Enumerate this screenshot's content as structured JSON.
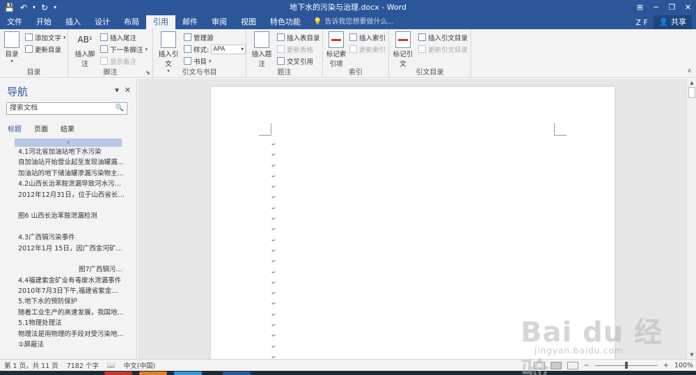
{
  "titlebar": {
    "title": "地下水的污染与治理.docx - Word",
    "save_icon": "💾",
    "undo_icon": "↶",
    "redo_icon": "↻",
    "dropdown_icon": "▾",
    "ribbon_display_icon": "⊞",
    "minimize_icon": "─",
    "restore_icon": "❐",
    "close_icon": "✕"
  },
  "tabs": [
    "文件",
    "开始",
    "插入",
    "设计",
    "布局",
    "引用",
    "邮件",
    "审阅",
    "视图",
    "特色功能"
  ],
  "active_tab": "引用",
  "tellme": {
    "icon": "💡",
    "text": "告诉我您想要做什么..."
  },
  "user": {
    "initials": "Z F",
    "share_icon": "👤",
    "share_label": "共享"
  },
  "ribbon": {
    "toc": {
      "label": "目录",
      "toc_button": "目录",
      "add_text": "添加文字",
      "update_toc": "更新目录"
    },
    "footnotes": {
      "label": "脚注",
      "insert_footnote": "插入脚注",
      "footnote_icon": "AB¹",
      "insert_endnote": "插入尾注",
      "next_footnote": "下一条脚注",
      "show_notes": "显示备注"
    },
    "citations": {
      "label": "引文与书目",
      "insert_citation": "插入引文",
      "manage_sources": "管理源",
      "style_label": "样式:",
      "style_value": "APA",
      "bibliography": "书目"
    },
    "captions": {
      "label": "题注",
      "insert_caption": "插入题注",
      "insert_table_of_figures": "插入表目录",
      "update_table": "更新表格",
      "cross_reference": "交叉引用"
    },
    "index": {
      "label": "索引",
      "mark_entry": "标记索引项",
      "insert_index": "插入索引",
      "update_index": "更新索引"
    },
    "toa": {
      "label": "引文目录",
      "mark_citation": "标记引文",
      "insert_toa": "插入引文目录",
      "update_toa": "更新引文目录"
    },
    "collapse_icon": "∧"
  },
  "navigation": {
    "title": "导航",
    "search_placeholder": "搜索文档",
    "search_icon": "🔍",
    "tabs": [
      "标题",
      "页面",
      "结果"
    ],
    "active_tab": "标题",
    "collapse_arrow": "⩡",
    "headings": [
      {
        "text": "4.1河北省加油站地下水污染",
        "indent": false
      },
      {
        "text": "自加油站开始营业起至发现油罐漏...",
        "indent": false
      },
      {
        "text": "加油站的地下储油罐渗漏污染物主...",
        "indent": false
      },
      {
        "text": "4.2山西长治苯胺泄漏导致河水污染...",
        "indent": false
      },
      {
        "text": "2012年12月31日，位于山西省长治...",
        "indent": false
      },
      {
        "text": "",
        "indent": false
      },
      {
        "text": "图6  山西长治苯胺泄漏检测",
        "indent": false
      },
      {
        "text": "",
        "indent": false
      },
      {
        "text": "4.3广西镉污染事件",
        "indent": false
      },
      {
        "text": "2012年1月 15日，因广西金河矿业...",
        "indent": false
      },
      {
        "text": "",
        "indent": false
      },
      {
        "text": "图7广西镉污...",
        "indent": true
      },
      {
        "text": "4.4福建紫金矿业有毒废水泄漏事件",
        "indent": false
      },
      {
        "text": "2010年7月3日下午,福建省紫金矿业...",
        "indent": false
      },
      {
        "text": "5.地下水的预防保护",
        "indent": false
      },
      {
        "text": "随着工业生产的高速发展，我国地...",
        "indent": false
      },
      {
        "text": "5.1物理处理法",
        "indent": false
      },
      {
        "text": "物理法是用物理的手段对受污染地...",
        "indent": false
      },
      {
        "text": "①屏蔽法",
        "indent": false
      }
    ]
  },
  "document": {
    "paragraph_mark": "↵"
  },
  "statusbar": {
    "page": "第 1 页，共 11 页",
    "words": "7182 个字",
    "proof_icon": "📖",
    "language": "中文(中国)",
    "zoom_minus": "−",
    "zoom_plus": "+",
    "zoom": "100%"
  },
  "watermark": {
    "logo": "Bai du 经验",
    "url": "jingyan.baidu.com"
  }
}
